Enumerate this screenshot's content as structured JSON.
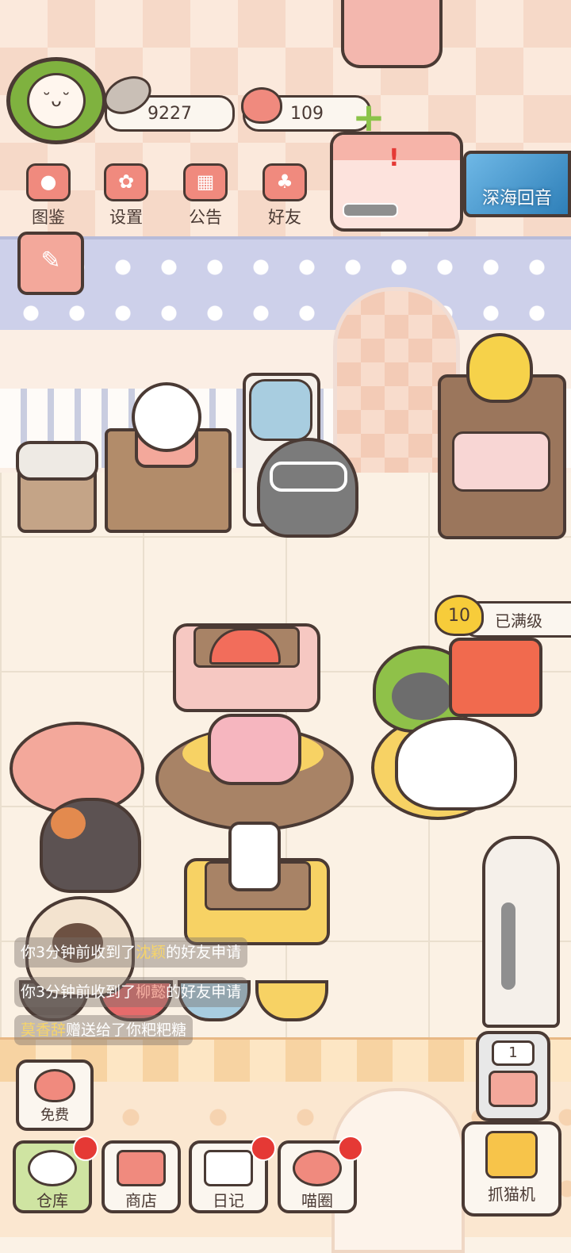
{
  "currency": {
    "coins": "9227",
    "hearts": "109"
  },
  "menu": [
    {
      "label": "图鉴",
      "icon": "cat-head-icon"
    },
    {
      "label": "设置",
      "icon": "gear-icon"
    },
    {
      "label": "公告",
      "icon": "gift-icon"
    },
    {
      "label": "好友",
      "icon": "friends-icon"
    }
  ],
  "event_banner": {
    "label": "深海回音"
  },
  "cat_level": {
    "level": "10",
    "status": "已满级"
  },
  "notifications": [
    {
      "prefix": "你3分钟前收到了",
      "name": "沈颖",
      "suffix": "的好友申请"
    },
    {
      "prefix": "你3分钟前收到了",
      "name": "柳懿",
      "suffix": "的好友申请"
    },
    {
      "prefix": "",
      "name": "莫香辞",
      "suffix": "赠送给了你粑粑糖"
    }
  ],
  "free_button": {
    "label": "免费"
  },
  "bottom_nav": [
    {
      "label": "仓库",
      "icon": "storage-icon"
    },
    {
      "label": "商店",
      "icon": "shop-icon"
    },
    {
      "label": "日记",
      "icon": "diary-icon"
    },
    {
      "label": "喵圈",
      "icon": "cat-planet-icon"
    }
  ],
  "gacha": {
    "count": "1",
    "claw_label": "抓猫机"
  },
  "colors": {
    "accent": "#f08a7e",
    "outline": "#4a3a34",
    "badge_red": "#e53935",
    "highlight_name": "#f6d46a"
  }
}
